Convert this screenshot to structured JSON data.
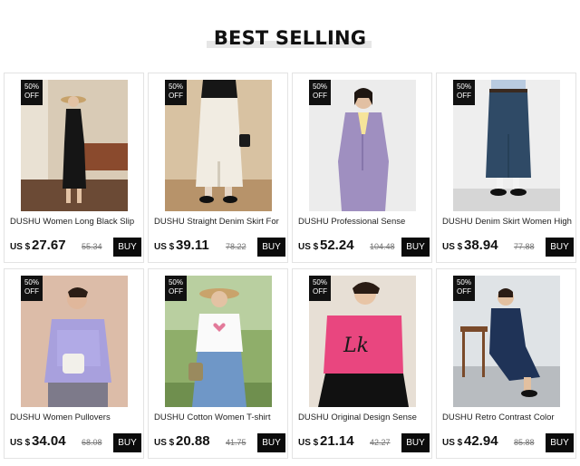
{
  "section": {
    "title": "BEST SELLING"
  },
  "products": [
    {
      "badge_line1": "50%",
      "badge_line2": "OFF",
      "name": "DUSHU Women Long Black Slip",
      "currency": "US $",
      "price": "27.67",
      "old_price": "55.34",
      "buy_label": "BUY"
    },
    {
      "badge_line1": "50%",
      "badge_line2": "OFF",
      "name": "DUSHU Straight Denim Skirt For",
      "currency": "US $",
      "price": "39.11",
      "old_price": "78.22",
      "buy_label": "BUY"
    },
    {
      "badge_line1": "50%",
      "badge_line2": "OFF",
      "name": "DUSHU Professional Sense",
      "currency": "US $",
      "price": "52.24",
      "old_price": "104.48",
      "buy_label": "BUY"
    },
    {
      "badge_line1": "50%",
      "badge_line2": "OFF",
      "name": "DUSHU Denim Skirt Women High",
      "currency": "US $",
      "price": "38.94",
      "old_price": "77.88",
      "buy_label": "BUY"
    },
    {
      "badge_line1": "50%",
      "badge_line2": "OFF",
      "name": "DUSHU Women Pullovers",
      "currency": "US $",
      "price": "34.04",
      "old_price": "68.08",
      "buy_label": "BUY"
    },
    {
      "badge_line1": "50%",
      "badge_line2": "OFF",
      "name": "DUSHU Cotton Women T-shirt",
      "currency": "US $",
      "price": "20.88",
      "old_price": "41.75",
      "buy_label": "BUY"
    },
    {
      "badge_line1": "50%",
      "badge_line2": "OFF",
      "name": "DUSHU Original Design Sense",
      "currency": "US $",
      "price": "21.14",
      "old_price": "42.27",
      "buy_label": "BUY"
    },
    {
      "badge_line1": "50%",
      "badge_line2": "OFF",
      "name": "DUSHU Retro Contrast Color",
      "currency": "US $",
      "price": "42.94",
      "old_price": "85.88",
      "buy_label": "BUY"
    }
  ],
  "colors": {
    "badge_bg": "#111111",
    "buy_bg": "#0b0b0b",
    "title_underline": "#e6e6e6"
  }
}
